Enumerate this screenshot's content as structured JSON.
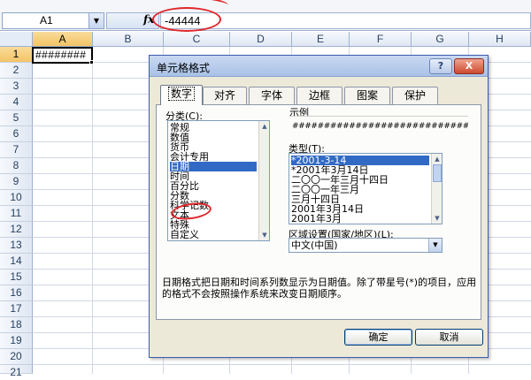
{
  "formula_bar": {
    "name_box": "A1",
    "fx_symbol": "fx",
    "formula_value": "-44444"
  },
  "sheet": {
    "columns": [
      "A",
      "B",
      "C",
      "D",
      "E",
      "F",
      "G",
      "H"
    ],
    "rows": [
      "1",
      "2",
      "3",
      "4",
      "5",
      "6",
      "7",
      "8",
      "9",
      "10",
      "11",
      "12",
      "13",
      "14",
      "15",
      "16",
      "17",
      "18",
      "19",
      "20",
      "21"
    ],
    "active_cell_display": "########"
  },
  "dialog": {
    "title": "单元格格式",
    "help_glyph": "?",
    "close_glyph": "X",
    "tabs": [
      "数字",
      "对齐",
      "字体",
      "边框",
      "图案",
      "保护"
    ],
    "active_tab": "数字",
    "category_label": "分类(C):",
    "categories": [
      "常规",
      "数值",
      "货币",
      "会计专用",
      "日期",
      "时间",
      "百分比",
      "分数",
      "科学记数",
      "文本",
      "特殊",
      "自定义"
    ],
    "selected_category": "日期",
    "sample_label": "示例",
    "sample_value": "################################",
    "type_label": "类型(T):",
    "types": [
      "*2001-3-14",
      "*2001年3月14日",
      "二〇〇一年三月十四日",
      "二〇〇一年三月",
      "三月十四日",
      "2001年3月14日",
      "2001年3月"
    ],
    "selected_type": "*2001-3-14",
    "locale_label": "区域设置(国家/地区)(L):",
    "locale_value": "中文(中国)",
    "description": "日期格式把日期和时间系列数显示为日期值。除了带星号(*)的项目，应用的格式不会按照操作系统来改变日期顺序。",
    "ok_label": "确定",
    "cancel_label": "取消"
  },
  "colors": {
    "annotation_red": "#e0262a",
    "selection_blue": "#316ac5",
    "dialog_face": "#ece9d8"
  }
}
